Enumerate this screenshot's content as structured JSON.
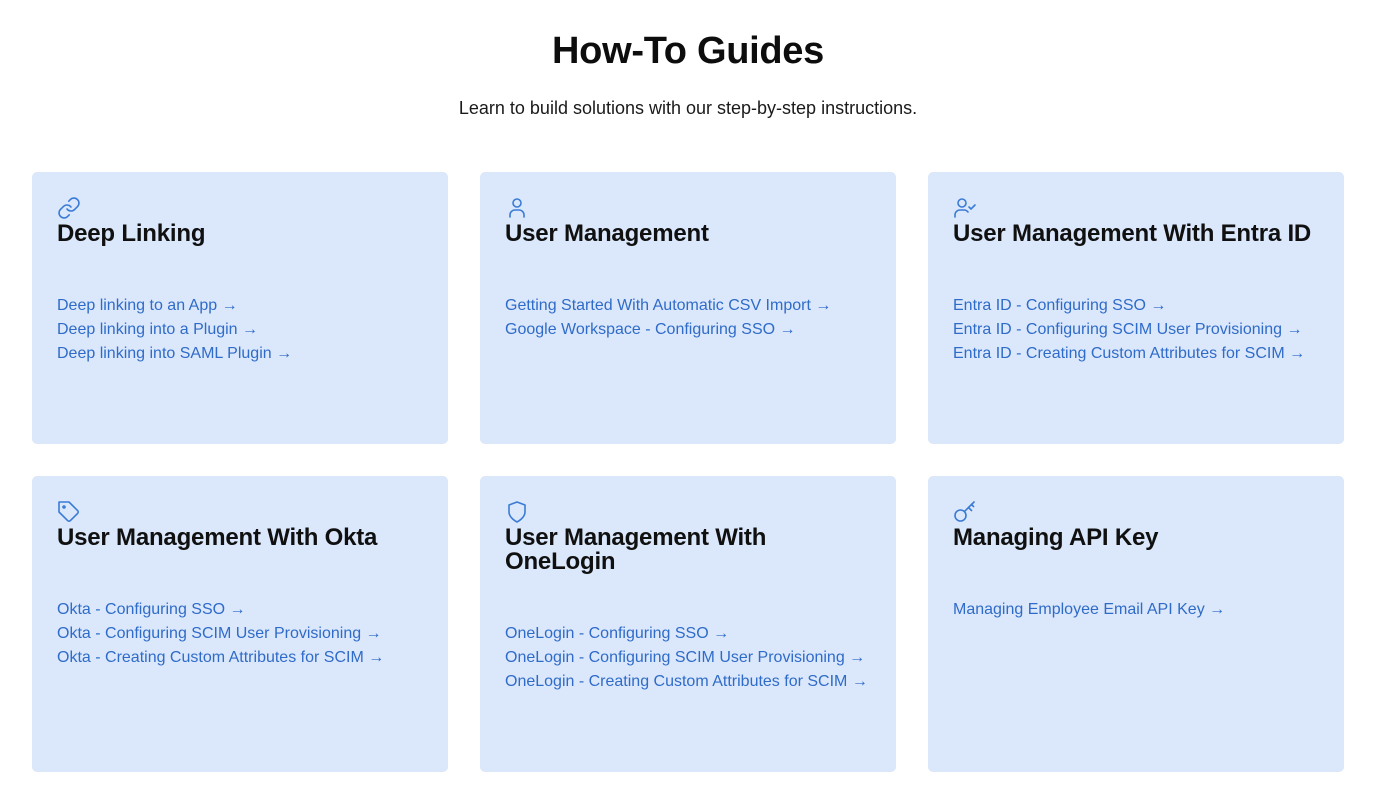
{
  "header": {
    "title": "How-To Guides",
    "subtitle": "Learn to build solutions with our step-by-step instructions."
  },
  "colors": {
    "card_bg": "#dbe8fc",
    "link": "#2f6bc8",
    "icon": "#3a7bd5"
  },
  "cards": [
    {
      "icon": "link-icon",
      "title": "Deep Linking",
      "links": [
        "Deep linking to an App →",
        "Deep linking into a Plugin →",
        "Deep linking into SAML Plugin →"
      ]
    },
    {
      "icon": "user-icon",
      "title": "User Management",
      "links": [
        "Getting Started With Automatic CSV Import →",
        "Google Workspace - Configuring SSO →"
      ]
    },
    {
      "icon": "user-check-icon",
      "title": "User Management With Entra ID",
      "links": [
        "Entra ID - Configuring SSO →",
        "Entra ID - Configuring SCIM User Provisioning →",
        "Entra ID - Creating Custom Attributes for SCIM →"
      ]
    },
    {
      "icon": "tag-icon",
      "title": "User Management With Okta",
      "links": [
        "Okta - Configuring SSO →",
        "Okta - Configuring SCIM User Provisioning →",
        "Okta - Creating Custom Attributes for SCIM →"
      ]
    },
    {
      "icon": "shield-icon",
      "title": "User Management With OneLogin",
      "links": [
        "OneLogin - Configuring SSO →",
        "OneLogin - Configuring SCIM User Provisioning →",
        "OneLogin - Creating Custom Attributes for SCIM →"
      ]
    },
    {
      "icon": "key-icon",
      "title": "Managing API Key",
      "links": [
        "Managing Employee Email API Key →"
      ]
    }
  ]
}
